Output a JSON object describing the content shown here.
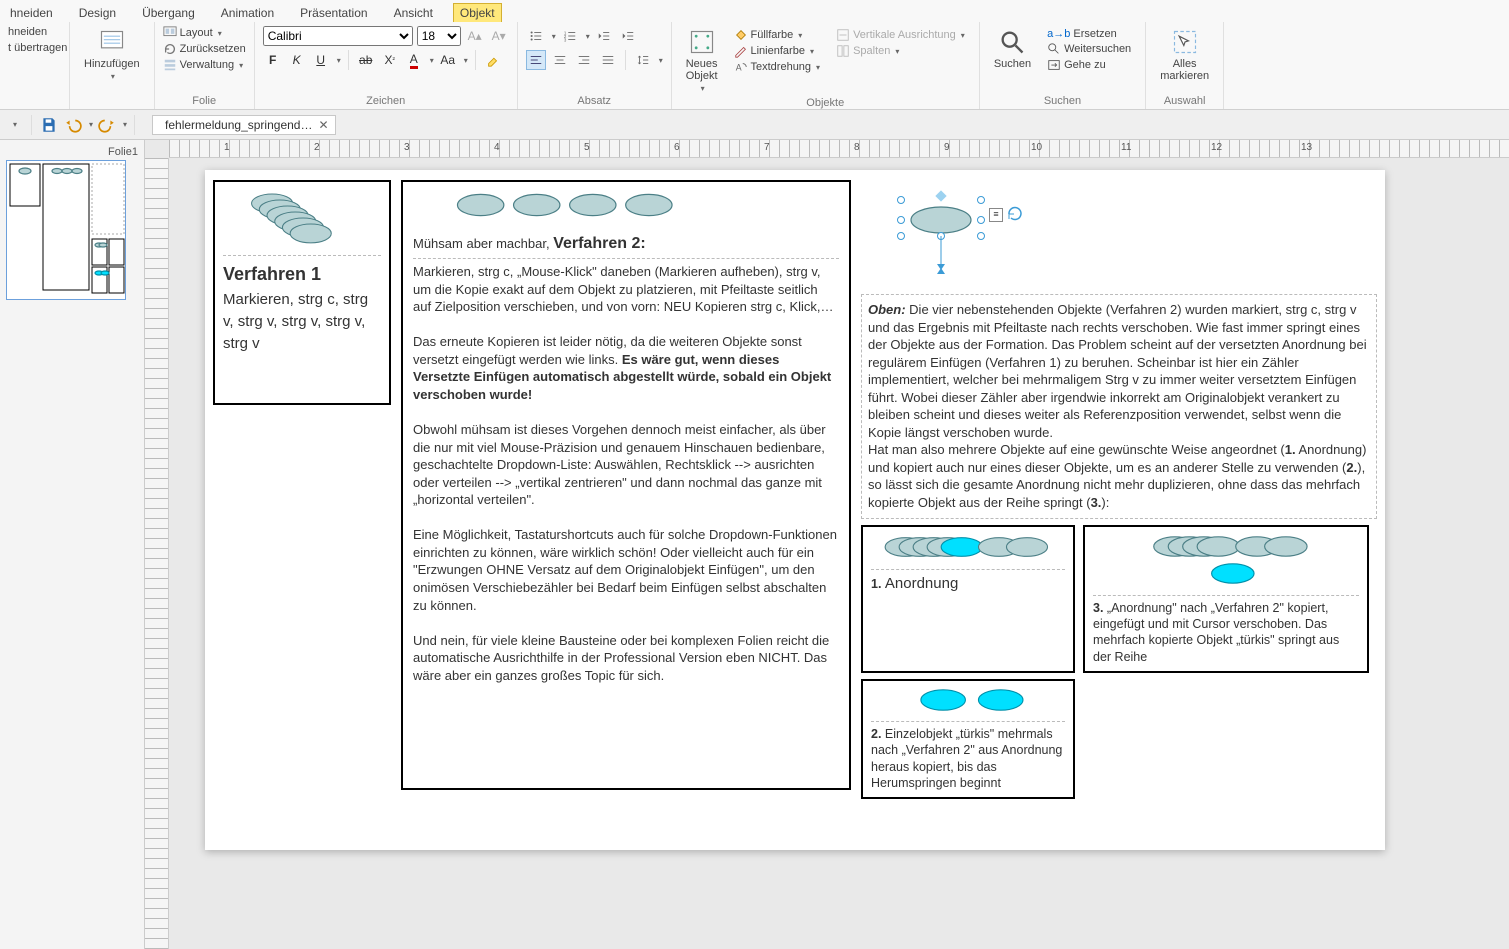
{
  "tabs": {
    "t0": "hneiden",
    "t1": "Design",
    "t2": "Übergang",
    "t3": "Animation",
    "t4": "Präsentation",
    "t5": "Ansicht",
    "t6": "Objekt"
  },
  "clipboard": {
    "l0": "hneiden",
    "l1": "",
    "l2": "t übertragen",
    "add": "Hinzufügen"
  },
  "folie": {
    "lbl": "Folie",
    "layout": "Layout",
    "reset": "Zurücksetzen",
    "manage": "Verwaltung"
  },
  "draw": {
    "lbl": "Zeichen",
    "font": "Calibri",
    "size": "18"
  },
  "para": {
    "lbl": "Absatz"
  },
  "obj": {
    "lbl": "Objekte",
    "new": "Neues\nObjekt",
    "fill": "Füllfarbe",
    "line": "Linienfarbe",
    "rot": "Textdrehung",
    "valign": "Vertikale Ausrichtung",
    "cols": "Spalten"
  },
  "search": {
    "lbl": "Suchen",
    "btn": "Suchen",
    "replace": "Ersetzen",
    "next": "Weitersuchen",
    "goto": "Gehe zu"
  },
  "select": {
    "lbl": "Auswahl",
    "all": "Alles\nmarkieren"
  },
  "doc": {
    "name": "fehlermeldung_springend…"
  },
  "thumbs": {
    "lbl": "Folie1"
  },
  "slide": {
    "v1_title": "Verfahren 1",
    "v1_body": "Markieren, strg c, strg v, strg v, strg v, strg v, strg v",
    "v2_lead": "Mühsam aber machbar, ",
    "v2_title": "Verfahren 2:",
    "v2_p1": "Markieren, strg c, „Mouse-Klick\" daneben (Markieren aufheben), strg v, um die Kopie exakt auf dem Objekt zu platzieren, mit Pfeiltaste seitlich auf Zielposition verschieben, und von vorn: NEU Kopieren strg c, Klick,…",
    "v2_p2a": "Das erneute Kopieren ist leider nötig, da die weiteren Objekte sonst versetzt eingefügt werden wie links. ",
    "v2_p2b": "Es wäre gut, wenn dieses Versetzte Einfügen automatisch abgestellt würde, sobald ein Objekt verschoben wurde!",
    "v2_p3": "Obwohl mühsam ist dieses Vorgehen dennoch meist einfacher, als über die nur mit viel Mouse-Präzision und genauem Hinschauen bedienbare, geschachtelte Dropdown-Liste: Auswählen, Rechtsklick --> ausrichten oder verteilen --> „vertikal zentrieren\" und dann nochmal das ganze mit „horizontal verteilen\".",
    "v2_p4": "Eine Möglichkeit, Tastaturshortcuts auch für solche Dropdown-Funktionen einrichten zu können, wäre wirklich schön! Oder vielleicht auch für ein \"Erzwungen OHNE Versatz auf dem Originalobjekt Einfügen\", um den onimösen Verschiebezähler bei Bedarf beim Einfügen selbst abschalten zu können.",
    "v2_p5": "Und nein, für viele kleine Bausteine oder bei komplexen Folien reicht die automatische Ausrichthilfe in der Professional Version eben NICHT. Das wäre aber ein ganzes großes Topic für sich.",
    "c_top_b": "Oben: ",
    "c_top": "Die vier nebenstehenden Objekte (Verfahren 2) wurden markiert, strg c, strg v und das Ergebnis mit Pfeiltaste nach rechts verschoben. Wie fast immer springt eines der Objekte aus der Formation. Das Problem scheint auf der versetzten Anordnung bei regulärem Einfügen (Verfahren 1) zu beruhen. Scheinbar ist hier ein Zähler implementiert, welcher bei mehrmaligem Strg v zu immer weiter versetztem Einfügen führt. Wobei dieser Zähler aber irgendwie inkorrekt am Originalobjekt verankert zu bleiben scheint und dieses weiter als Referenzposition verwendet, selbst wenn die Kopie längst verschoben wurde.",
    "c_bot_a": "Hat man also mehrere Objekte auf eine gewünschte Weise angeordnet (",
    "c_bot_b": "1.",
    "c_bot_c": " Anordnung) und kopiert auch nur eines dieser Objekte, um es an anderer Stelle zu verwenden (",
    "c_bot_d": "2.",
    "c_bot_e": "), so lässt sich die gesamte Anordnung nicht mehr duplizieren, ohne dass das mehrfach kopierte Objekt aus der Reihe springt (",
    "c_bot_f": "3.",
    "c_bot_g": "):",
    "g1_t": "1. ",
    "g1": "Anordnung",
    "g2_t": "2. ",
    "g2": "Einzelobjekt „türkis\" mehrmals nach „Verfahren 2\" aus Anordnung heraus kopiert, bis das Herumspringen beginnt",
    "g3_t": "3. ",
    "g3": "„Anordnung\" nach „Verfahren 2\" kopiert, eingefügt und mit Cursor verschoben. Das mehrfach kopierte Objekt „türkis\" springt aus der Reihe"
  }
}
